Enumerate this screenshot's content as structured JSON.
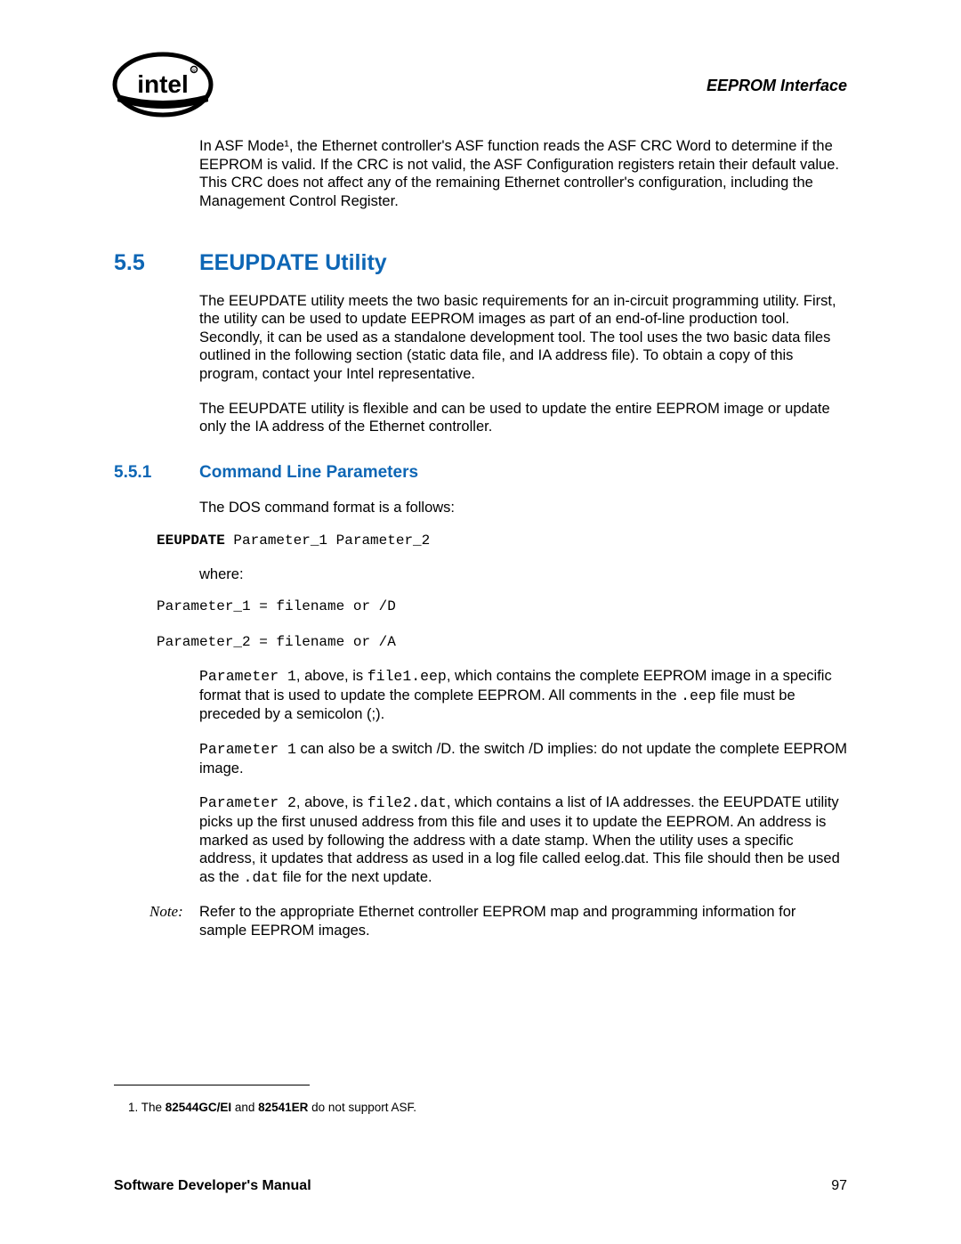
{
  "header": {
    "section_title": "EEPROM Interface"
  },
  "intro_para": "In ASF Mode¹, the Ethernet controller's ASF function reads the ASF CRC Word to determine if the EEPROM is valid. If the CRC is not valid, the ASF Configuration registers retain their default value. This CRC does not affect any of the remaining Ethernet controller's configuration, including the Management Control Register.",
  "h1": {
    "num": "5.5",
    "title": "EEUPDATE Utility"
  },
  "p1": "The EEUPDATE utility meets the two basic requirements for an in-circuit programming utility. First, the utility can be used to update EEPROM images as part of an end-of-line production tool. Secondly, it can be used as a standalone development tool. The tool uses the two basic data files outlined in the following section (static data file, and IA address file). To obtain a copy of this program, contact your Intel representative.",
  "p2": "The EEUPDATE utility is flexible and can be used to update the entire EEPROM image or update only the IA address of the Ethernet controller.",
  "h2": {
    "num": "5.5.1",
    "title": "Command Line Parameters"
  },
  "p3": "The DOS command format is a follows:",
  "code1_bold": "EEUPDATE",
  "code1_rest": " Parameter_1 Parameter_2",
  "where": "where:",
  "code2_line1": "Parameter_1 = filename or /D",
  "code2_line2": "Parameter_2 = filename or /A",
  "p4_a": "Parameter 1",
  "p4_b": ", above, is ",
  "p4_c": "file1.eep",
  "p4_d": ", which contains the complete EEPROM image in a specific format that is used to update the complete EEPROM. All comments in the ",
  "p4_e": ".eep",
  "p4_f": " file must be preceded by a semicolon (;).",
  "p5_a": "Parameter 1",
  "p5_b": " can also be a switch /D. the switch /D implies: do not update the complete EEPROM image.",
  "p6_a": "Parameter 2",
  "p6_b": ", above, is ",
  "p6_c": "file2.dat",
  "p6_d": ", which contains a list of IA addresses. the EEUPDATE utility picks up the first unused address from this file and uses it to update the EEPROM. An address is marked as used by following the address with a date stamp. When the utility uses a specific address, it updates that address as used in a log file called eelog.dat. This file should then be used as the ",
  "p6_e": ".dat",
  "p6_f": " file for the next update.",
  "note_label": "Note:",
  "note_body": "Refer to the appropriate Ethernet controller EEPROM map and programming information for sample EEPROM images.",
  "footnote_a": "1.    The ",
  "footnote_b": "82544GC/EI",
  "footnote_c": " and ",
  "footnote_d": "82541ER",
  "footnote_e": " do not support ASF.",
  "footer": {
    "left": "Software Developer's Manual",
    "right": "97"
  }
}
